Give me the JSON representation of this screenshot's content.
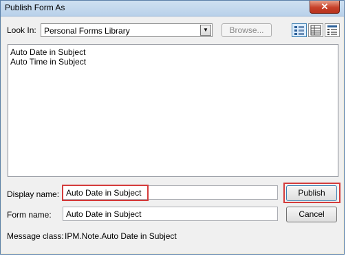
{
  "window": {
    "title": "Publish Form As",
    "close_symbol": "✕"
  },
  "look_in": {
    "label": "Look In:",
    "value": "Personal Forms Library"
  },
  "browse_button": {
    "label": "Browse..."
  },
  "view_buttons": [
    {
      "icon": "large-icons-view-icon"
    },
    {
      "icon": "details-view-icon"
    },
    {
      "icon": "list-view-icon"
    }
  ],
  "forms_list": [
    "Auto Date in Subject",
    "Auto Time in Subject"
  ],
  "display_name": {
    "label": "Display name:",
    "value": "Auto Date in Subject"
  },
  "form_name": {
    "label": "Form name:",
    "value": "Auto Date in Subject"
  },
  "message_class": {
    "label": "Message class:",
    "value": "IPM.Note.Auto Date in Subject"
  },
  "buttons": {
    "publish": "Publish",
    "cancel": "Cancel"
  },
  "colors": {
    "highlight": "#d43b3b",
    "title_bar": "#b9d1ea",
    "dialog_bg": "#f0f0f0"
  }
}
